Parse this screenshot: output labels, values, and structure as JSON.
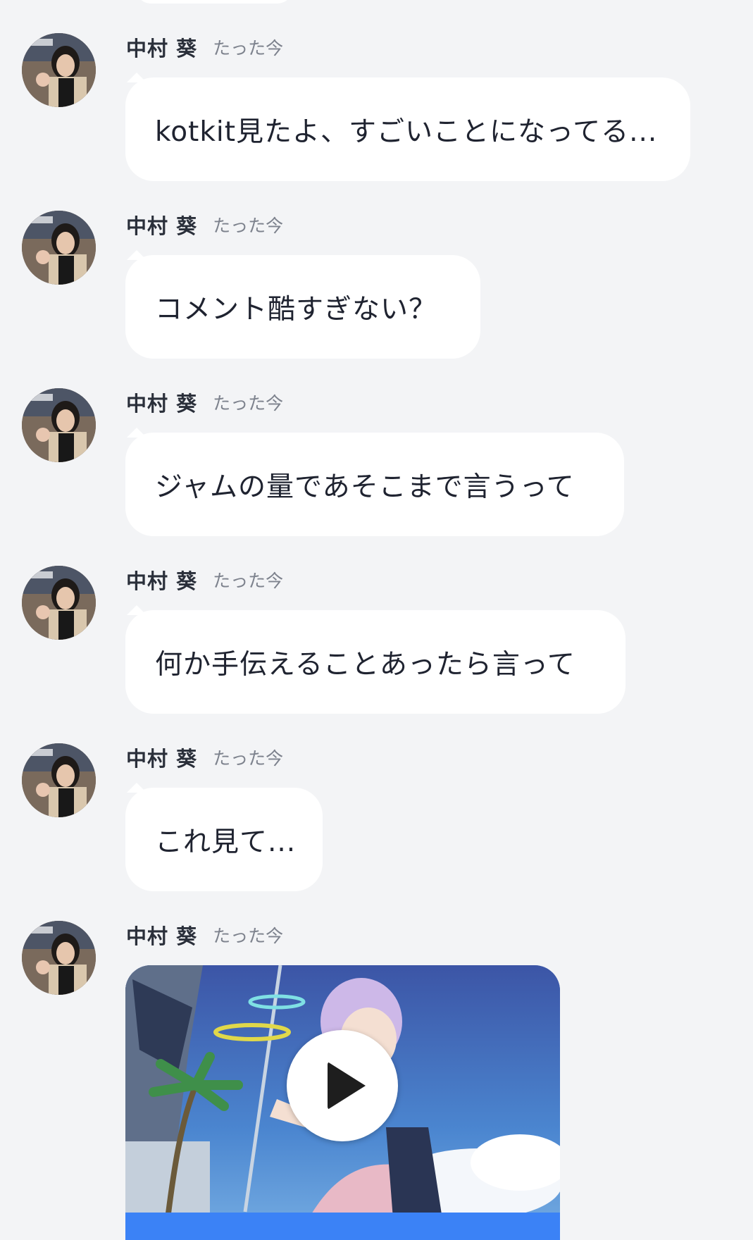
{
  "messages": [
    {
      "sender": "中村 葵",
      "time": "たった今",
      "text": "kotkit見たよ、すごいことになってる..."
    },
    {
      "sender": "中村 葵",
      "time": "たった今",
      "text": "コメント酷すぎない？"
    },
    {
      "sender": "中村 葵",
      "time": "たった今",
      "text": "ジャムの量であそこまで言うって"
    },
    {
      "sender": "中村 葵",
      "time": "たった今",
      "text": "何か手伝えることあったら言って"
    },
    {
      "sender": "中村 葵",
      "time": "たった今",
      "text": "これ見て..."
    },
    {
      "sender": "中村 葵",
      "time": "たった今",
      "media": "video"
    }
  ],
  "colors": {
    "background": "#f3f4f6",
    "bubble": "#ffffff",
    "accent": "#3b82f6"
  },
  "icons": {
    "play": "play-icon",
    "avatar": "avatar"
  }
}
